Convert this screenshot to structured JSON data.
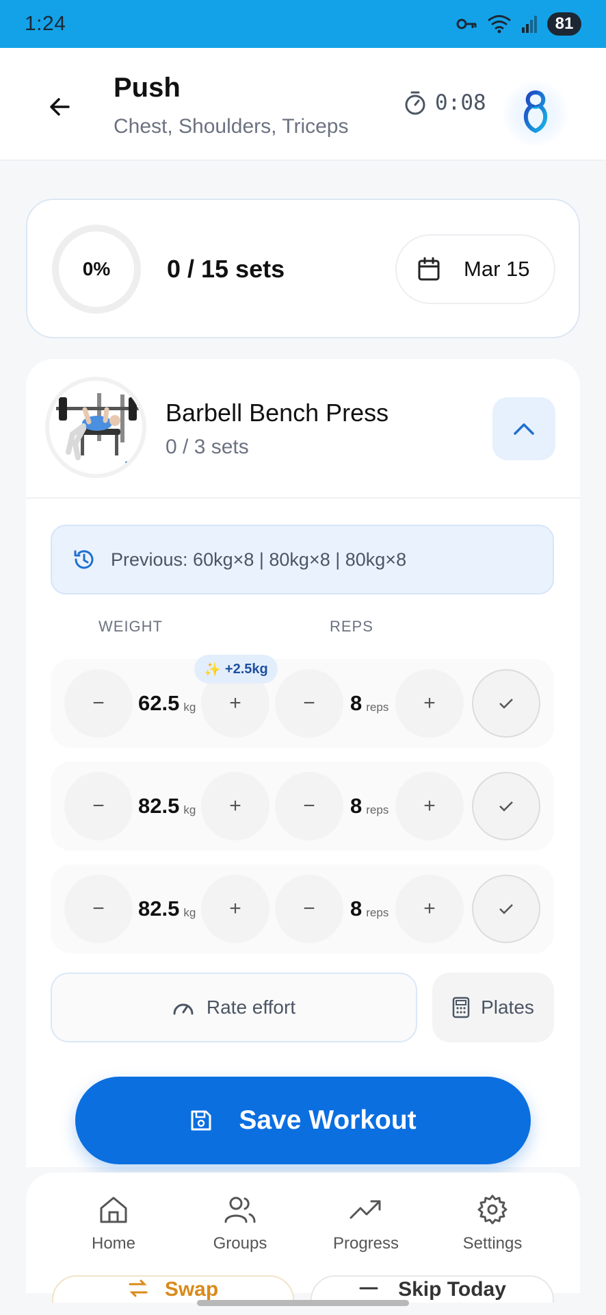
{
  "status_bar": {
    "time": "1:24",
    "battery": "81"
  },
  "header": {
    "title": "Push",
    "subtitle": "Chest, Shoulders, Triceps",
    "timer": "0:08"
  },
  "summary": {
    "progress_label": "0%",
    "progress_fraction": 0,
    "sets_label": "0 / 15 sets",
    "date": "Mar 15"
  },
  "exercise": {
    "name": "Barbell Bench Press",
    "sets_label": "0 / 3 sets",
    "previous": "Previous: 60kg×8 | 80kg×8 | 80kg×8",
    "weight_header": "WEIGHT",
    "reps_header": "REPS",
    "hint": "+2.5kg",
    "weight_unit": "kg",
    "reps_unit": "reps",
    "sets": [
      {
        "weight": "62.5",
        "reps": "8"
      },
      {
        "weight": "82.5",
        "reps": "8"
      },
      {
        "weight": "82.5",
        "reps": "8"
      }
    ],
    "rate_effort": "Rate effort",
    "plates": "Plates",
    "swap": "Swap",
    "skip": "Skip Today"
  },
  "save_button": "Save Workout",
  "nav": {
    "items": [
      {
        "label": "Home",
        "icon": "home-icon"
      },
      {
        "label": "Groups",
        "icon": "groups-icon"
      },
      {
        "label": "Progress",
        "icon": "trending-up-icon"
      },
      {
        "label": "Settings",
        "icon": "gear-icon"
      }
    ]
  },
  "colors": {
    "status_bar": "#13a2e8",
    "accent": "#0b6fe0",
    "swap": "#d98a1a"
  }
}
